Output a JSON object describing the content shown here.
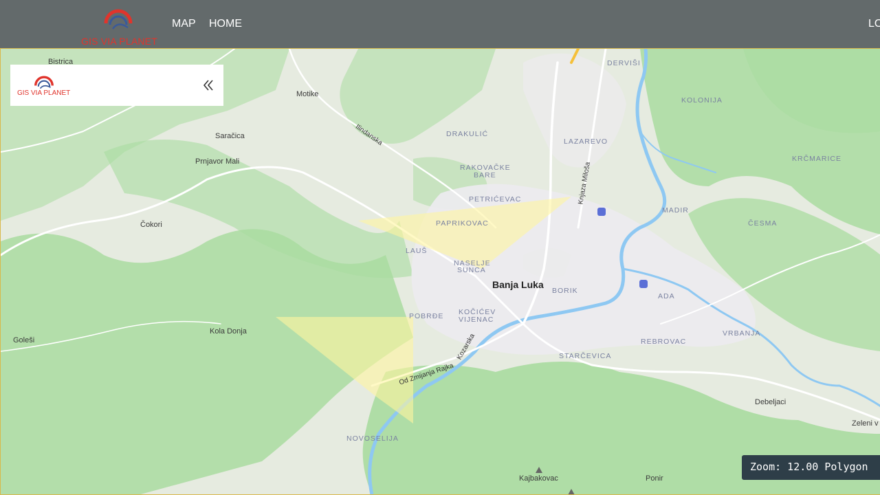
{
  "header": {
    "brand_text": "GIS VIA PLANET",
    "nav": [
      {
        "label": "MAP"
      },
      {
        "label": "HOME"
      }
    ],
    "login_label": "LO"
  },
  "panel": {
    "logo_text": "GIS VIA PLANET",
    "collapse_icon": "double-chevron-left-icon"
  },
  "zoom_status": "Zoom: 12.00 Polygon",
  "map": {
    "place_labels": [
      {
        "id": "bistrica",
        "text": "Bistrica"
      },
      {
        "id": "motike",
        "text": "Motike"
      },
      {
        "id": "saracica",
        "text": "Saračica"
      },
      {
        "id": "prnjavor-mali",
        "text": "Prnjavor Mali"
      },
      {
        "id": "cokori",
        "text": "Čokori"
      },
      {
        "id": "golesi",
        "text": "Goleši"
      },
      {
        "id": "kola-donja",
        "text": "Kola Donja"
      },
      {
        "id": "debeljaci",
        "text": "Debeljaci"
      },
      {
        "id": "zeleni-v",
        "text": "Zeleni v"
      },
      {
        "id": "ponir",
        "text": "Ponir"
      },
      {
        "id": "kajbakovac",
        "text": "Kajbakovac"
      }
    ],
    "district_labels": [
      {
        "id": "dervisi",
        "text": "DERVIŠI"
      },
      {
        "id": "kolonija",
        "text": "KOLONIJA"
      },
      {
        "id": "drakulic",
        "text": "DRAKULIĆ"
      },
      {
        "id": "lazarevo",
        "text": "LAZAREVO"
      },
      {
        "id": "rakovacke",
        "text": "RAKOVAČKE"
      },
      {
        "id": "bare",
        "text": "BARE"
      },
      {
        "id": "krcmarice",
        "text": "KRČMARICE"
      },
      {
        "id": "petricevac",
        "text": "PETRIĆEVAC"
      },
      {
        "id": "madir",
        "text": "MADIR"
      },
      {
        "id": "paprikovac",
        "text": "PAPRIKOVAC"
      },
      {
        "id": "cesma",
        "text": "ČESMA"
      },
      {
        "id": "laus",
        "text": "LAUŠ"
      },
      {
        "id": "naselje",
        "text": "NASELJE"
      },
      {
        "id": "sunca",
        "text": "SUNCA"
      },
      {
        "id": "borik",
        "text": "BORIK"
      },
      {
        "id": "ada",
        "text": "ADA"
      },
      {
        "id": "pobrde",
        "text": "POBRĐE"
      },
      {
        "id": "kocicev",
        "text": "KOČIĆEV"
      },
      {
        "id": "vijenac",
        "text": "VIJENAC"
      },
      {
        "id": "rebrovac",
        "text": "REBROVAC"
      },
      {
        "id": "vrbanja",
        "text": "VRBANJA"
      },
      {
        "id": "starcevica",
        "text": "STARČEVICA"
      },
      {
        "id": "novoselija",
        "text": "NOVOSELIJA"
      }
    ],
    "city_label": "Banja Luka",
    "road_labels": [
      {
        "id": "ilindanska",
        "text": "Ilindanska"
      },
      {
        "id": "knjaza-milosa",
        "text": "Knjaza Miloša"
      },
      {
        "id": "kozarska",
        "text": "Kozarska"
      },
      {
        "id": "od-zmijanja-rajka",
        "text": "Od Zmijanja Rajka"
      }
    ],
    "colors": {
      "forest": "#a9dca0",
      "open_land": "#e8ede2",
      "urban": "#ecebee",
      "river": "#8ec8f2",
      "polygon_fill": "#fff5a0"
    }
  }
}
